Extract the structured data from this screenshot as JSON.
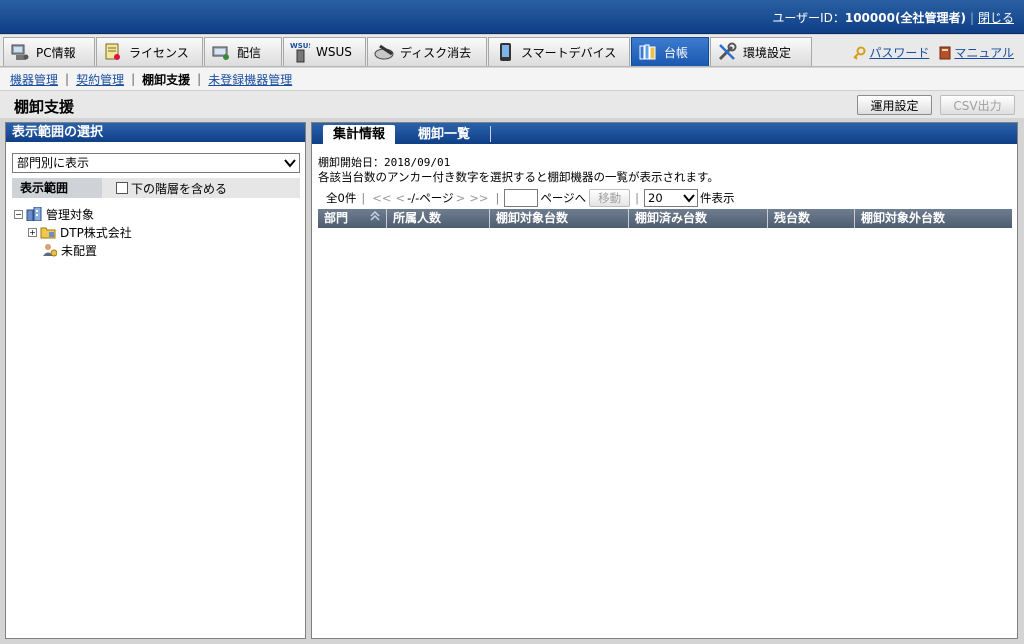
{
  "header": {
    "user_label": "ユーザーID：",
    "user_id": "100000(全社管理者)",
    "logout": "閉じる"
  },
  "tabs": [
    {
      "label": "PC情報",
      "icon": "pc-icon"
    },
    {
      "label": "ライセンス",
      "icon": "license-icon"
    },
    {
      "label": "配信",
      "icon": "delivery-icon"
    },
    {
      "label": "WSUS",
      "icon": "wsus-icon"
    },
    {
      "label": "ディスク消去",
      "icon": "disk-erase-icon"
    },
    {
      "label": "スマートデバイス",
      "icon": "smartphone-icon"
    },
    {
      "label": "台帳",
      "icon": "ledger-icon"
    },
    {
      "label": "環境設定",
      "icon": "settings-icon"
    }
  ],
  "right_links": {
    "password": "パスワード",
    "manual": "マニュアル"
  },
  "subnav": {
    "item1": "機器管理",
    "item2": "契約管理",
    "current": "棚卸支援",
    "item4": "未登録機器管理"
  },
  "page": {
    "title": "棚卸支援",
    "btn_settings": "運用設定",
    "btn_csv": "CSV出力"
  },
  "left_panel": {
    "header": "表示範囲の選択",
    "select_value": "部門別に表示",
    "scope_label": "表示範囲",
    "include_sub": "下の階層を含める",
    "tree": {
      "root": "管理対象",
      "child": "DTP株式会社",
      "unassigned": "未配置"
    }
  },
  "right_panel": {
    "tab_summary": "集計情報",
    "tab_list": "棚卸一覧",
    "start_date": "棚卸開始日：2018/09/01",
    "description": "各該当台数のアンカー付き数字を選択すると棚卸機器の一覧が表示されます。",
    "pager": {
      "total": "全0件",
      "first": "<<",
      "prev": "<",
      "page_info": "-/-ページ",
      "next": ">",
      "last": ">>",
      "goto": "ページへ",
      "move": "移動",
      "per_page": "20",
      "per_page_suffix": "件表示"
    },
    "columns": [
      "部門",
      "所属人数",
      "棚卸対象台数",
      "棚卸済み台数",
      "残台数",
      "棚卸対象外台数"
    ]
  }
}
